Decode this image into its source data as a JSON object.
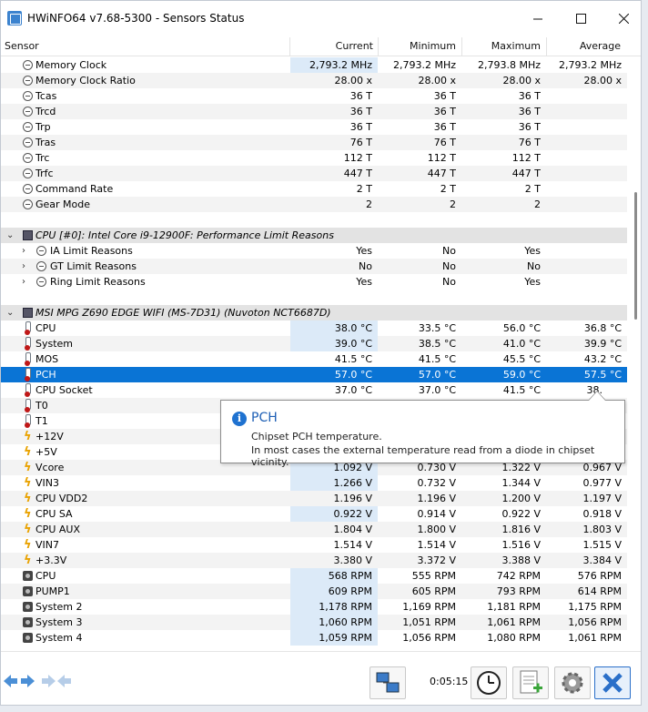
{
  "window": {
    "title": "HWiNFO64 v7.68-5300 - Sensors Status",
    "minimize": "—",
    "maximize": "☐",
    "close": "✕"
  },
  "columns": {
    "sensor": "Sensor",
    "current": "Current",
    "minimum": "Minimum",
    "maximum": "Maximum",
    "average": "Average"
  },
  "memory_rows": [
    {
      "name": "Memory Clock",
      "current": "2,793.2 MHz",
      "minimum": "2,793.2 MHz",
      "maximum": "2,793.8 MHz",
      "average": "2,793.2 MHz"
    },
    {
      "name": "Memory Clock Ratio",
      "current": "28.00 x",
      "minimum": "28.00 x",
      "maximum": "28.00 x",
      "average": "28.00 x"
    },
    {
      "name": "Tcas",
      "current": "36 T",
      "minimum": "36 T",
      "maximum": "36 T",
      "average": ""
    },
    {
      "name": "Trcd",
      "current": "36 T",
      "minimum": "36 T",
      "maximum": "36 T",
      "average": ""
    },
    {
      "name": "Trp",
      "current": "36 T",
      "minimum": "36 T",
      "maximum": "36 T",
      "average": ""
    },
    {
      "name": "Tras",
      "current": "76 T",
      "minimum": "76 T",
      "maximum": "76 T",
      "average": ""
    },
    {
      "name": "Trc",
      "current": "112 T",
      "minimum": "112 T",
      "maximum": "112 T",
      "average": ""
    },
    {
      "name": "Trfc",
      "current": "447 T",
      "minimum": "447 T",
      "maximum": "447 T",
      "average": ""
    },
    {
      "name": "Command Rate",
      "current": "2 T",
      "minimum": "2 T",
      "maximum": "2 T",
      "average": ""
    },
    {
      "name": "Gear Mode",
      "current": "2",
      "minimum": "2",
      "maximum": "2",
      "average": ""
    }
  ],
  "cpu_group": {
    "title": "CPU [#0]: Intel Core i9-12900F: Performance Limit Reasons",
    "rows": [
      {
        "name": "IA Limit Reasons",
        "current": "Yes",
        "minimum": "No",
        "maximum": "Yes",
        "average": ""
      },
      {
        "name": "GT Limit Reasons",
        "current": "No",
        "minimum": "No",
        "maximum": "No",
        "average": ""
      },
      {
        "name": "Ring Limit Reasons",
        "current": "Yes",
        "minimum": "No",
        "maximum": "Yes",
        "average": ""
      }
    ]
  },
  "mb_group": {
    "title": "MSI MPG Z690 EDGE WIFI (MS-7D31) (Nuvoton NCT6687D)",
    "rows": [
      {
        "name": "CPU",
        "kind": "temp",
        "current": "38.0 °C",
        "minimum": "33.5 °C",
        "maximum": "56.0 °C",
        "average": "36.8 °C"
      },
      {
        "name": "System",
        "kind": "temp",
        "current": "39.0 °C",
        "minimum": "38.5 °C",
        "maximum": "41.0 °C",
        "average": "39.9 °C"
      },
      {
        "name": "MOS",
        "kind": "temp",
        "current": "41.5 °C",
        "minimum": "41.5 °C",
        "maximum": "45.5 °C",
        "average": "43.2 °C"
      },
      {
        "name": "PCH",
        "kind": "temp",
        "current": "57.0 °C",
        "minimum": "57.0 °C",
        "maximum": "59.0 °C",
        "average": "57.5 °C"
      },
      {
        "name": "CPU Socket",
        "kind": "temp",
        "current": "37.0 °C",
        "minimum": "37.0 °C",
        "maximum": "41.5 °C",
        "average": "38."
      },
      {
        "name": "T0",
        "kind": "temp",
        "current": "",
        "minimum": "",
        "maximum": "",
        "average": ""
      },
      {
        "name": "T1",
        "kind": "temp",
        "current": "",
        "minimum": "",
        "maximum": "",
        "average": ""
      },
      {
        "name": "+12V",
        "kind": "volt",
        "current": "",
        "minimum": "",
        "maximum": "",
        "average": ""
      },
      {
        "name": "+5V",
        "kind": "volt",
        "current": "",
        "minimum": "",
        "maximum": "",
        "average": ""
      },
      {
        "name": "Vcore",
        "kind": "volt",
        "current": "1.092 V",
        "minimum": "0.730 V",
        "maximum": "1.322 V",
        "average": "0.967 V"
      },
      {
        "name": "VIN3",
        "kind": "volt",
        "current": "1.266 V",
        "minimum": "0.732 V",
        "maximum": "1.344 V",
        "average": "0.977 V"
      },
      {
        "name": "CPU VDD2",
        "kind": "volt",
        "current": "1.196 V",
        "minimum": "1.196 V",
        "maximum": "1.200 V",
        "average": "1.197 V"
      },
      {
        "name": "CPU SA",
        "kind": "volt",
        "current": "0.922 V",
        "minimum": "0.914 V",
        "maximum": "0.922 V",
        "average": "0.918 V"
      },
      {
        "name": "CPU AUX",
        "kind": "volt",
        "current": "1.804 V",
        "minimum": "1.800 V",
        "maximum": "1.816 V",
        "average": "1.803 V"
      },
      {
        "name": "VIN7",
        "kind": "volt",
        "current": "1.514 V",
        "minimum": "1.514 V",
        "maximum": "1.516 V",
        "average": "1.515 V"
      },
      {
        "name": "+3.3V",
        "kind": "volt",
        "current": "3.380 V",
        "minimum": "3.372 V",
        "maximum": "3.388 V",
        "average": "3.384 V"
      },
      {
        "name": "CPU",
        "kind": "fan",
        "current": "568 RPM",
        "minimum": "555 RPM",
        "maximum": "742 RPM",
        "average": "576 RPM"
      },
      {
        "name": "PUMP1",
        "kind": "fan",
        "current": "609 RPM",
        "minimum": "605 RPM",
        "maximum": "793 RPM",
        "average": "614 RPM"
      },
      {
        "name": "System 2",
        "kind": "fan",
        "current": "1,178 RPM",
        "minimum": "1,169 RPM",
        "maximum": "1,181 RPM",
        "average": "1,175 RPM"
      },
      {
        "name": "System 3",
        "kind": "fan",
        "current": "1,060 RPM",
        "minimum": "1,051 RPM",
        "maximum": "1,061 RPM",
        "average": "1,056 RPM"
      },
      {
        "name": "System 4",
        "kind": "fan",
        "current": "1,059 RPM",
        "minimum": "1,056 RPM",
        "maximum": "1,080 RPM",
        "average": "1,061 RPM"
      }
    ]
  },
  "tooltip": {
    "title": "PCH",
    "line1": "Chipset PCH temperature.",
    "line2": "In most cases the external temperature read from a diode in chipset vicinity."
  },
  "toolbar": {
    "timer": "0:05:15"
  },
  "colors": {
    "selection": "#0a74d5",
    "current_highlight": "#dceaf8",
    "group_row": "#e3e3e3",
    "tooltip_title": "#1d5fb5"
  }
}
